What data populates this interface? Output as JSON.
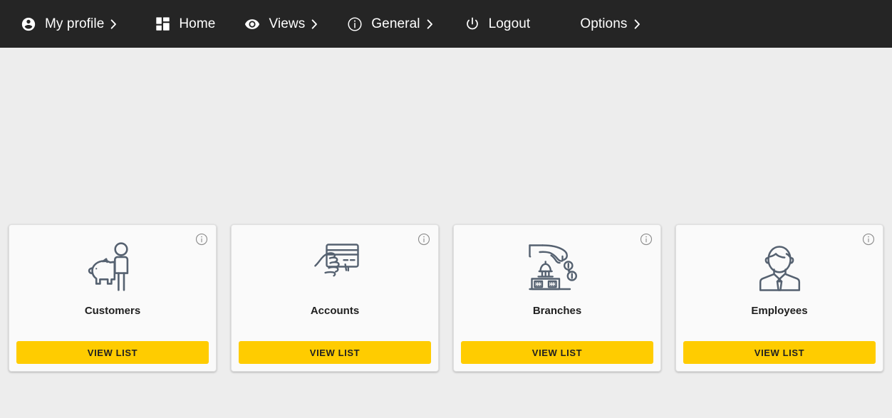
{
  "navbar": {
    "background_color": "#252525",
    "items": [
      {
        "id": "my-profile",
        "label": "My profile",
        "icon": "account-circle-icon",
        "chevron": "›"
      },
      {
        "id": "home",
        "label": "Home",
        "icon": "dashboard-grid-icon",
        "chevron": ""
      },
      {
        "id": "views",
        "label": "Views",
        "icon": "eye-icon",
        "chevron": "›"
      },
      {
        "id": "general",
        "label": "General",
        "icon": "info-circle-icon",
        "chevron": "›"
      },
      {
        "id": "logout",
        "label": "Logout",
        "icon": "power-icon",
        "chevron": ""
      },
      {
        "id": "options",
        "label": "Options",
        "icon": "",
        "chevron": "›"
      }
    ]
  },
  "page": {
    "background_color": "#ededed"
  },
  "cards": {
    "accent_color": "#ffcc00",
    "icon_color": "#556170",
    "info_icon_name": "info-circle-icon",
    "items": [
      {
        "id": "customers",
        "title": "Customers",
        "icon": "customer-piggybank-icon",
        "button_label": "VIEW LIST"
      },
      {
        "id": "accounts",
        "title": "Accounts",
        "icon": "hand-credit-card-icon",
        "button_label": "VIEW LIST"
      },
      {
        "id": "branches",
        "title": "Branches",
        "icon": "bank-coins-hand-icon",
        "button_label": "VIEW LIST"
      },
      {
        "id": "employees",
        "title": "Employees",
        "icon": "businessman-icon",
        "button_label": "VIEW LIST"
      }
    ]
  }
}
